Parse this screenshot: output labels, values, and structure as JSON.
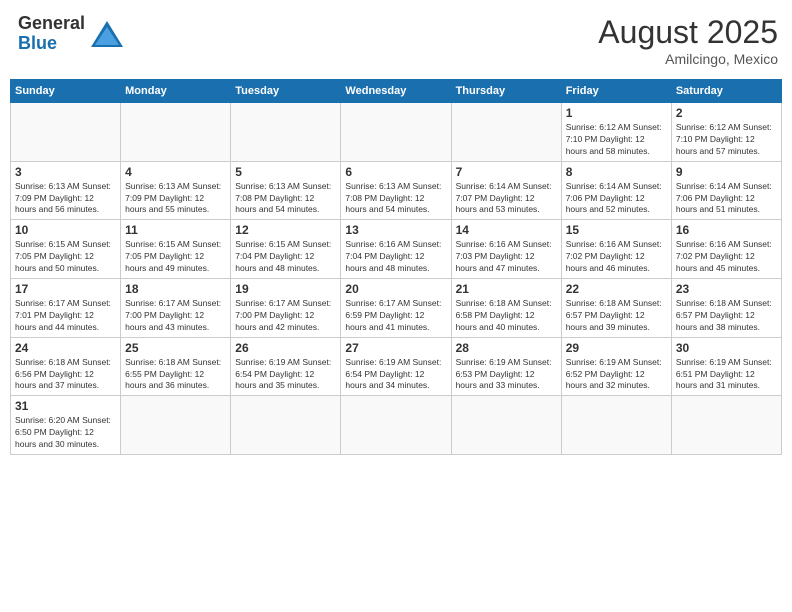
{
  "header": {
    "logo_general": "General",
    "logo_blue": "Blue",
    "month_title": "August 2025",
    "location": "Amilcingo, Mexico"
  },
  "days_of_week": [
    "Sunday",
    "Monday",
    "Tuesday",
    "Wednesday",
    "Thursday",
    "Friday",
    "Saturday"
  ],
  "weeks": [
    [
      {
        "day": "",
        "info": ""
      },
      {
        "day": "",
        "info": ""
      },
      {
        "day": "",
        "info": ""
      },
      {
        "day": "",
        "info": ""
      },
      {
        "day": "",
        "info": ""
      },
      {
        "day": "1",
        "info": "Sunrise: 6:12 AM\nSunset: 7:10 PM\nDaylight: 12 hours\nand 58 minutes."
      },
      {
        "day": "2",
        "info": "Sunrise: 6:12 AM\nSunset: 7:10 PM\nDaylight: 12 hours\nand 57 minutes."
      }
    ],
    [
      {
        "day": "3",
        "info": "Sunrise: 6:13 AM\nSunset: 7:09 PM\nDaylight: 12 hours\nand 56 minutes."
      },
      {
        "day": "4",
        "info": "Sunrise: 6:13 AM\nSunset: 7:09 PM\nDaylight: 12 hours\nand 55 minutes."
      },
      {
        "day": "5",
        "info": "Sunrise: 6:13 AM\nSunset: 7:08 PM\nDaylight: 12 hours\nand 54 minutes."
      },
      {
        "day": "6",
        "info": "Sunrise: 6:13 AM\nSunset: 7:08 PM\nDaylight: 12 hours\nand 54 minutes."
      },
      {
        "day": "7",
        "info": "Sunrise: 6:14 AM\nSunset: 7:07 PM\nDaylight: 12 hours\nand 53 minutes."
      },
      {
        "day": "8",
        "info": "Sunrise: 6:14 AM\nSunset: 7:06 PM\nDaylight: 12 hours\nand 52 minutes."
      },
      {
        "day": "9",
        "info": "Sunrise: 6:14 AM\nSunset: 7:06 PM\nDaylight: 12 hours\nand 51 minutes."
      }
    ],
    [
      {
        "day": "10",
        "info": "Sunrise: 6:15 AM\nSunset: 7:05 PM\nDaylight: 12 hours\nand 50 minutes."
      },
      {
        "day": "11",
        "info": "Sunrise: 6:15 AM\nSunset: 7:05 PM\nDaylight: 12 hours\nand 49 minutes."
      },
      {
        "day": "12",
        "info": "Sunrise: 6:15 AM\nSunset: 7:04 PM\nDaylight: 12 hours\nand 48 minutes."
      },
      {
        "day": "13",
        "info": "Sunrise: 6:16 AM\nSunset: 7:04 PM\nDaylight: 12 hours\nand 48 minutes."
      },
      {
        "day": "14",
        "info": "Sunrise: 6:16 AM\nSunset: 7:03 PM\nDaylight: 12 hours\nand 47 minutes."
      },
      {
        "day": "15",
        "info": "Sunrise: 6:16 AM\nSunset: 7:02 PM\nDaylight: 12 hours\nand 46 minutes."
      },
      {
        "day": "16",
        "info": "Sunrise: 6:16 AM\nSunset: 7:02 PM\nDaylight: 12 hours\nand 45 minutes."
      }
    ],
    [
      {
        "day": "17",
        "info": "Sunrise: 6:17 AM\nSunset: 7:01 PM\nDaylight: 12 hours\nand 44 minutes."
      },
      {
        "day": "18",
        "info": "Sunrise: 6:17 AM\nSunset: 7:00 PM\nDaylight: 12 hours\nand 43 minutes."
      },
      {
        "day": "19",
        "info": "Sunrise: 6:17 AM\nSunset: 7:00 PM\nDaylight: 12 hours\nand 42 minutes."
      },
      {
        "day": "20",
        "info": "Sunrise: 6:17 AM\nSunset: 6:59 PM\nDaylight: 12 hours\nand 41 minutes."
      },
      {
        "day": "21",
        "info": "Sunrise: 6:18 AM\nSunset: 6:58 PM\nDaylight: 12 hours\nand 40 minutes."
      },
      {
        "day": "22",
        "info": "Sunrise: 6:18 AM\nSunset: 6:57 PM\nDaylight: 12 hours\nand 39 minutes."
      },
      {
        "day": "23",
        "info": "Sunrise: 6:18 AM\nSunset: 6:57 PM\nDaylight: 12 hours\nand 38 minutes."
      }
    ],
    [
      {
        "day": "24",
        "info": "Sunrise: 6:18 AM\nSunset: 6:56 PM\nDaylight: 12 hours\nand 37 minutes."
      },
      {
        "day": "25",
        "info": "Sunrise: 6:18 AM\nSunset: 6:55 PM\nDaylight: 12 hours\nand 36 minutes."
      },
      {
        "day": "26",
        "info": "Sunrise: 6:19 AM\nSunset: 6:54 PM\nDaylight: 12 hours\nand 35 minutes."
      },
      {
        "day": "27",
        "info": "Sunrise: 6:19 AM\nSunset: 6:54 PM\nDaylight: 12 hours\nand 34 minutes."
      },
      {
        "day": "28",
        "info": "Sunrise: 6:19 AM\nSunset: 6:53 PM\nDaylight: 12 hours\nand 33 minutes."
      },
      {
        "day": "29",
        "info": "Sunrise: 6:19 AM\nSunset: 6:52 PM\nDaylight: 12 hours\nand 32 minutes."
      },
      {
        "day": "30",
        "info": "Sunrise: 6:19 AM\nSunset: 6:51 PM\nDaylight: 12 hours\nand 31 minutes."
      }
    ],
    [
      {
        "day": "31",
        "info": "Sunrise: 6:20 AM\nSunset: 6:50 PM\nDaylight: 12 hours\nand 30 minutes."
      },
      {
        "day": "",
        "info": ""
      },
      {
        "day": "",
        "info": ""
      },
      {
        "day": "",
        "info": ""
      },
      {
        "day": "",
        "info": ""
      },
      {
        "day": "",
        "info": ""
      },
      {
        "day": "",
        "info": ""
      }
    ]
  ]
}
